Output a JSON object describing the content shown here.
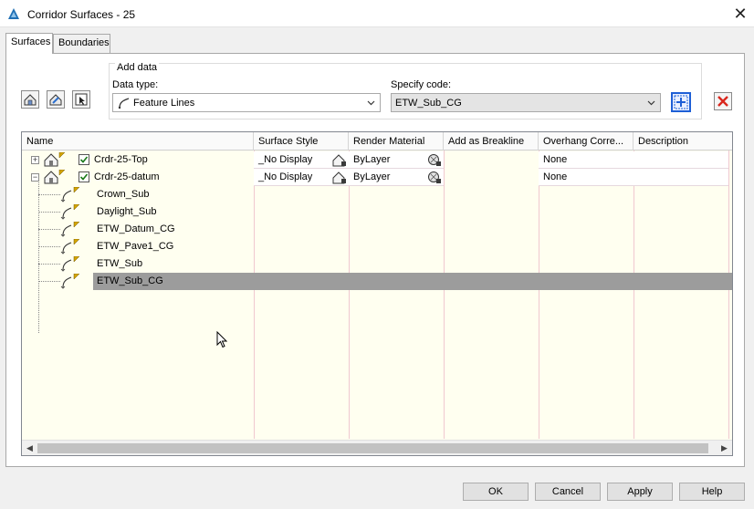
{
  "window": {
    "title": "Corridor Surfaces - 25",
    "close_glyph": "✕"
  },
  "tabs": [
    {
      "label": "Surfaces",
      "active": true
    },
    {
      "label": "Boundaries",
      "active": false
    }
  ],
  "toolbar": {
    "icons": [
      "create-surface-icon",
      "add-surface-item-icon",
      "select-from-drawing-icon"
    ]
  },
  "add_data": {
    "group_label": "Add data",
    "data_type_label": "Data type:",
    "data_type_value": "Feature Lines",
    "specify_code_label": "Specify code:",
    "specify_code_value": "ETW_Sub_CG"
  },
  "grid": {
    "columns": [
      "Name",
      "Surface Style",
      "Render Material",
      "Add as Breakline",
      "Overhang Corre...",
      "Description"
    ],
    "surfaces": [
      {
        "name": "Crdr-25-Top",
        "expander": "+",
        "checked": true,
        "surface_style": "_No Display",
        "render_material": "ByLayer",
        "overhang": "None"
      },
      {
        "name": "Crdr-25-datum",
        "expander": "−",
        "checked": true,
        "surface_style": "_No Display",
        "render_material": "ByLayer",
        "overhang": "None"
      }
    ],
    "children": [
      {
        "name": "Crown_Sub",
        "selected": false
      },
      {
        "name": "Daylight_Sub",
        "selected": false
      },
      {
        "name": "ETW_Datum_CG",
        "selected": false
      },
      {
        "name": "ETW_Pave1_CG",
        "selected": false
      },
      {
        "name": "ETW_Sub",
        "selected": false
      },
      {
        "name": "ETW_Sub_CG",
        "selected": true
      }
    ]
  },
  "buttons": {
    "ok": "OK",
    "cancel": "Cancel",
    "apply": "Apply",
    "help": "Help"
  },
  "colors": {
    "grid_background": "#fffff0",
    "selection": "#9c9c9c",
    "accent": "#1e5fd6",
    "delete": "#d9261c"
  }
}
